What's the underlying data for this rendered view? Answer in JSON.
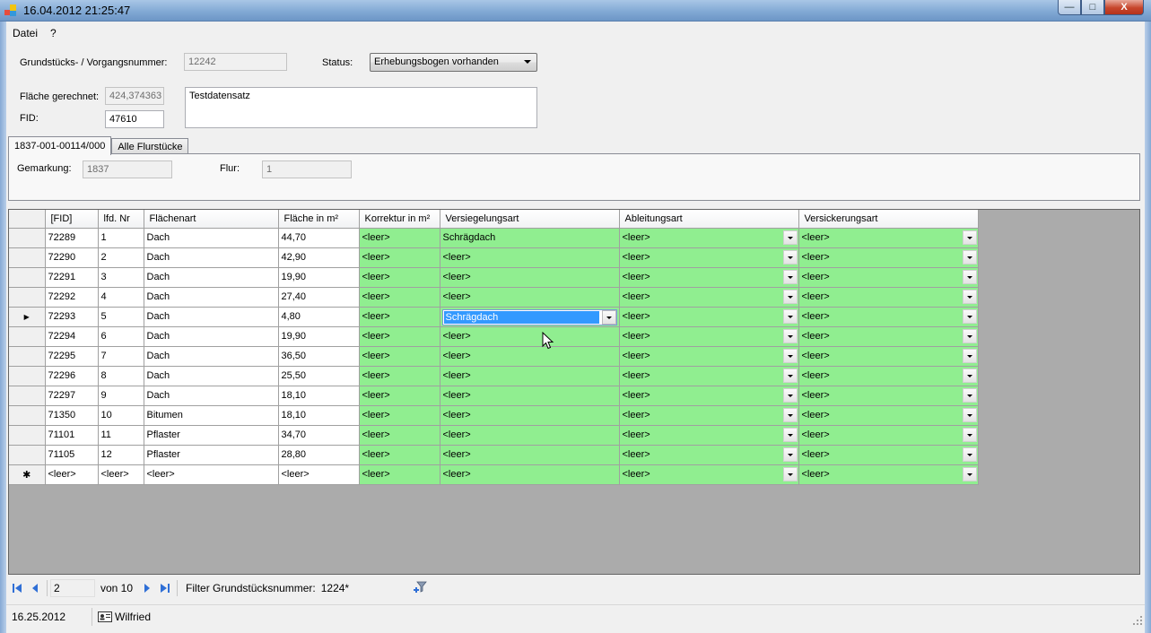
{
  "window": {
    "title": "16.04.2012 21:25:47",
    "minimize": "—",
    "maximize": "□",
    "close": "X"
  },
  "menu": [
    "Datei",
    "?"
  ],
  "form": {
    "grund_label": "Grundstücks- / Vorgangsnummer:",
    "grund_value": "12242",
    "status_label": "Status:",
    "status_value": "Erhebungsbogen vorhanden",
    "flaeche_label": "Fläche gerechnet:",
    "flaeche_value": "424,374363",
    "fid_label": "FID:",
    "fid_value": "47610",
    "notes_value": "Testdatensatz"
  },
  "tabs": [
    "1837-001-00114/000",
    "Alle Flurstücke"
  ],
  "tabpanel": {
    "gemarkung_label": "Gemarkung:",
    "gemarkung_value": "1837",
    "flur_label": "Flur:",
    "flur_value": "1"
  },
  "grid": {
    "columns": [
      "[FID]",
      "lfd. Nr",
      "Flächenart",
      "Fläche in m²",
      "Korrektur in m²",
      "Versiegelungsart",
      "Ableitungsart",
      "Versickerungsart"
    ],
    "rows": [
      [
        "72289",
        "1",
        "Dach",
        "44,70",
        "<leer>",
        "Schrägdach",
        "<leer>",
        "<leer>"
      ],
      [
        "72290",
        "2",
        "Dach",
        "42,90",
        "<leer>",
        "<leer>",
        "<leer>",
        "<leer>"
      ],
      [
        "72291",
        "3",
        "Dach",
        "19,90",
        "<leer>",
        "<leer>",
        "<leer>",
        "<leer>"
      ],
      [
        "72292",
        "4",
        "Dach",
        "27,40",
        "<leer>",
        "<leer>",
        "<leer>",
        "<leer>"
      ],
      [
        "72293",
        "5",
        "Dach",
        "4,80",
        "<leer>",
        "Schrägdach",
        "<leer>",
        "<leer>"
      ],
      [
        "72294",
        "6",
        "Dach",
        "19,90",
        "<leer>",
        "<leer>",
        "<leer>",
        "<leer>"
      ],
      [
        "72295",
        "7",
        "Dach",
        "36,50",
        "<leer>",
        "<leer>",
        "<leer>",
        "<leer>"
      ],
      [
        "72296",
        "8",
        "Dach",
        "25,50",
        "<leer>",
        "<leer>",
        "<leer>",
        "<leer>"
      ],
      [
        "72297",
        "9",
        "Dach",
        "18,10",
        "<leer>",
        "<leer>",
        "<leer>",
        "<leer>"
      ],
      [
        "71350",
        "10",
        "Bitumen",
        "18,10",
        "<leer>",
        "<leer>",
        "<leer>",
        "<leer>"
      ],
      [
        "71101",
        "11",
        "Pflaster",
        "34,70",
        "<leer>",
        "<leer>",
        "<leer>",
        "<leer>"
      ],
      [
        "71105",
        "12",
        "Pflaster",
        "28,80",
        "<leer>",
        "<leer>",
        "<leer>",
        "<leer>"
      ]
    ],
    "new_row": [
      "<leer>",
      "<leer>",
      "<leer>",
      "<leer>",
      "<leer>",
      "<leer>",
      "<leer>",
      "<leer>"
    ],
    "current_row_marker": "▶",
    "new_row_marker": "✱",
    "current_row_index": 4
  },
  "navigator": {
    "position": "2",
    "count_text": "von 10",
    "filter_label": "Filter Grundstücksnummer:",
    "filter_value": "1224*"
  },
  "statusbar": {
    "date": "16.25.2012",
    "user": "Wilfried"
  }
}
